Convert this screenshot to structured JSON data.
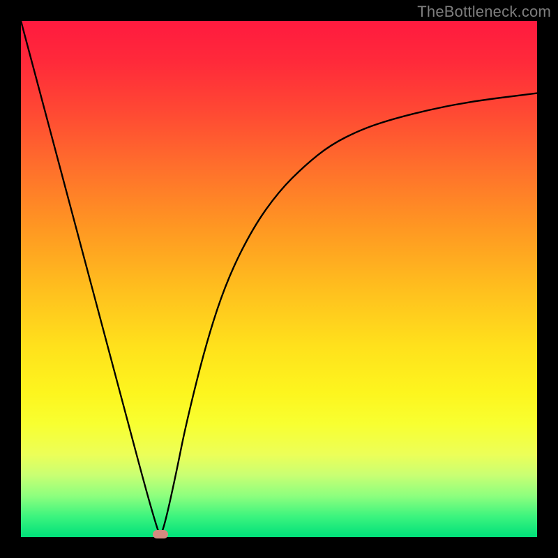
{
  "watermark": "TheBottleneck.com",
  "chart_data": {
    "type": "line",
    "title": "",
    "xlabel": "",
    "ylabel": "",
    "xlim": [
      0,
      100
    ],
    "ylim": [
      0,
      100
    ],
    "series": [
      {
        "name": "curve",
        "x": [
          0,
          4,
          8,
          12,
          16,
          20,
          24,
          26,
          27,
          28,
          30,
          32,
          36,
          40,
          45,
          50,
          55,
          60,
          66,
          72,
          80,
          88,
          96,
          100
        ],
        "y": [
          100,
          85,
          70,
          55,
          40,
          25,
          10,
          3,
          0,
          3,
          12,
          22,
          38,
          50,
          60,
          67,
          72,
          76,
          79,
          81,
          83,
          84.5,
          85.5,
          86
        ]
      }
    ],
    "marker": {
      "x": 27,
      "y": 0.5
    },
    "colors": {
      "curve": "#000000",
      "marker": "#d58a80",
      "frame": "#000000"
    }
  }
}
